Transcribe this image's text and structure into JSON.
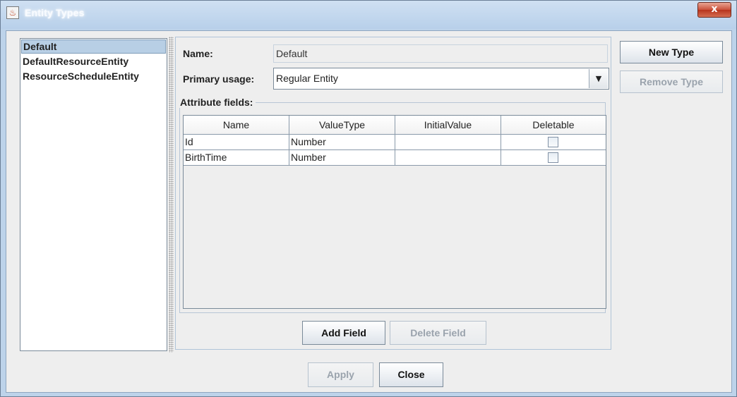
{
  "window": {
    "title": "Entity Types",
    "close_glyph": "x"
  },
  "entity_list": {
    "items": [
      {
        "label": "Default",
        "selected": true
      },
      {
        "label": "DefaultResourceEntity",
        "selected": false
      },
      {
        "label": "ResourceScheduleEntity",
        "selected": false
      }
    ]
  },
  "form": {
    "name_label": "Name:",
    "name_value": "Default",
    "primary_usage_label": "Primary usage:",
    "primary_usage_value": "Regular Entity",
    "dropdown_glyph": "▼",
    "attribute_fields_label": "Attribute fields:"
  },
  "table": {
    "columns": [
      "Name",
      "ValueType",
      "InitialValue",
      "Deletable"
    ],
    "rows": [
      {
        "name": "Id",
        "value_type": "Number",
        "initial_value": "",
        "deletable": false
      },
      {
        "name": "BirthTime",
        "value_type": "Number",
        "initial_value": "",
        "deletable": false
      }
    ]
  },
  "buttons": {
    "add_field": "Add Field",
    "delete_field": "Delete Field",
    "new_type": "New Type",
    "remove_type": "Remove Type",
    "apply": "Apply",
    "close": "Close"
  },
  "icons": {
    "app": "java-cup-icon",
    "window_close": "close-icon",
    "dropdown": "chevron-down-icon"
  }
}
